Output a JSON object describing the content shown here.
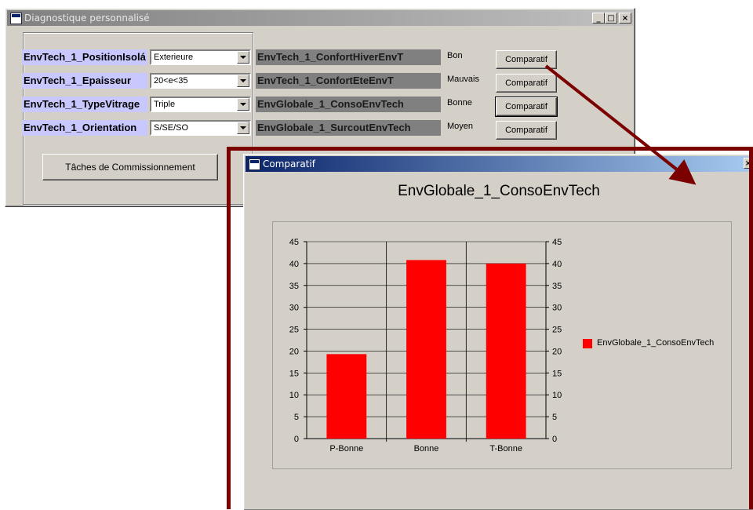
{
  "main_window": {
    "title": "Diagnostique personnalisé",
    "rows": [
      {
        "label": "EnvTech_1_PositionIsolá",
        "combo_value": "Exterieure",
        "indicator": "EnvTech_1_ConfortHiverEnvT",
        "status": "Bon",
        "button": "Comparatif"
      },
      {
        "label": "EnvTech_1_Epaisseur",
        "combo_value": "20<e<35",
        "indicator": "EnvTech_1_ConfortEteEnvT",
        "status": "Mauvais",
        "button": "Comparatif"
      },
      {
        "label": "EnvTech_1_TypeVitrage",
        "combo_value": "Triple",
        "indicator": "EnvGlobale_1_ConsoEnvTech",
        "status": "Bonne",
        "button": "Comparatif"
      },
      {
        "label": "EnvTech_1_Orientation",
        "combo_value": "S/SE/SO",
        "indicator": "EnvGlobale_1_SurcoutEnvTech",
        "status": "Moyen",
        "button": "Comparatif"
      }
    ],
    "commission_button": "Tâches de Commissionnement",
    "buttons": {
      "minimize": "_",
      "maximize": "□",
      "close": "×"
    }
  },
  "comparatif_window": {
    "title": "Comparatif",
    "close_button": "×"
  },
  "colors": {
    "bar": "#ff0000",
    "annotation": "#7b0000"
  },
  "chart_data": {
    "type": "bar",
    "title": "EnvGlobale_1_ConsoEnvTech",
    "categories": [
      "P-Bonne",
      "Bonne",
      "T-Bonne"
    ],
    "series": [
      {
        "name": "EnvGlobale_1_ConsoEnvTech",
        "values": [
          19.3,
          40.8,
          40.0
        ],
        "color": "#ff0000"
      }
    ],
    "ylim": [
      0,
      45
    ],
    "yticks": [
      0,
      5,
      10,
      15,
      20,
      25,
      30,
      35,
      40,
      45
    ],
    "grid": true,
    "legend": "right",
    "secondary_y_axis": true
  }
}
